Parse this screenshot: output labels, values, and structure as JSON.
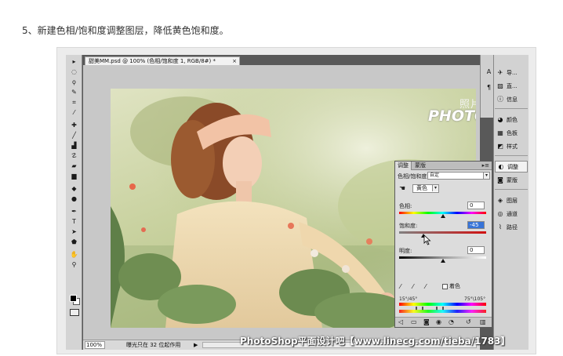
{
  "step_text": "5、新建色相/饱和度调整图层，降低黄色饱和度。",
  "document": {
    "tab_title": "甜美MM.psd @ 100% (色相/饱和度 1, RGB/8#) *",
    "close_glyph": "×"
  },
  "canvas_watermark": {
    "cn": "照片处理网",
    "en": "PHOTOPS.COM"
  },
  "status_bar": {
    "zoom": "100%",
    "info": "曝光只在 32 位起作用",
    "arrow": "▶"
  },
  "toolbar": {
    "tools": [
      {
        "name": "move-tool-icon",
        "glyph": "▸"
      },
      {
        "name": "marquee-tool-icon",
        "glyph": "◌"
      },
      {
        "name": "lasso-tool-icon",
        "glyph": "ϙ"
      },
      {
        "name": "quick-select-tool-icon",
        "glyph": "✎"
      },
      {
        "name": "crop-tool-icon",
        "glyph": "⌗"
      },
      {
        "name": "eyedropper-tool-icon",
        "glyph": "⁄"
      },
      {
        "name": "healing-tool-icon",
        "glyph": "✚"
      },
      {
        "name": "brush-tool-icon",
        "glyph": "╱"
      },
      {
        "name": "stamp-tool-icon",
        "glyph": "▟"
      },
      {
        "name": "history-brush-tool-icon",
        "glyph": "☡"
      },
      {
        "name": "eraser-tool-icon",
        "glyph": "▰"
      },
      {
        "name": "gradient-tool-icon",
        "glyph": "▆"
      },
      {
        "name": "blur-tool-icon",
        "glyph": "◆"
      },
      {
        "name": "dodge-tool-icon",
        "glyph": "●"
      },
      {
        "name": "pen-tool-icon",
        "glyph": "✒"
      },
      {
        "name": "type-tool-icon",
        "glyph": "T"
      },
      {
        "name": "path-select-tool-icon",
        "glyph": "➤"
      },
      {
        "name": "shape-tool-icon",
        "glyph": "⬟"
      },
      {
        "name": "hand-tool-icon",
        "glyph": "✋"
      },
      {
        "name": "zoom-tool-icon",
        "glyph": "⚲"
      }
    ]
  },
  "dock_left_icons": [
    {
      "name": "panel-collapse-icon",
      "glyph": "A"
    },
    {
      "name": "paragraph-icon",
      "glyph": "¶"
    }
  ],
  "dock": {
    "items": [
      {
        "name": "dock-item-navigator",
        "icon": "nav-icon",
        "glyph": "✈",
        "label": "导..."
      },
      {
        "name": "dock-item-histogram",
        "icon": "histogram-icon",
        "glyph": "▨",
        "label": "直..."
      },
      {
        "name": "dock-item-info",
        "icon": "info-icon",
        "glyph": "ⓘ",
        "label": "信息"
      },
      {
        "name": "dock-item-color",
        "icon": "color-icon",
        "glyph": "◕",
        "label": "颜色"
      },
      {
        "name": "dock-item-swatches",
        "icon": "swatches-icon",
        "glyph": "▦",
        "label": "色板"
      },
      {
        "name": "dock-item-styles",
        "icon": "styles-icon",
        "glyph": "◩",
        "label": "样式"
      },
      {
        "name": "dock-item-adjustments",
        "icon": "adjustments-icon",
        "glyph": "◐",
        "label": "调整"
      },
      {
        "name": "dock-item-masks",
        "icon": "masks-icon",
        "glyph": "◙",
        "label": "蒙版"
      },
      {
        "name": "dock-item-layers",
        "icon": "layers-icon",
        "glyph": "◈",
        "label": "图层"
      },
      {
        "name": "dock-item-channels",
        "icon": "channels-icon",
        "glyph": "◎",
        "label": "通道"
      },
      {
        "name": "dock-item-paths",
        "icon": "paths-icon",
        "glyph": "⌇",
        "label": "路径"
      }
    ]
  },
  "adjustments": {
    "tabs": [
      "调整",
      "蒙版"
    ],
    "menu_glyph": "▸≡",
    "title": "色相/饱和度",
    "preset": "自定",
    "select_arrow": "▾",
    "range": "黄色",
    "hue": {
      "label": "色相:",
      "value": "0",
      "slider": 0.5
    },
    "saturation": {
      "label": "饱和度:",
      "value": "-45",
      "slider": 0.275
    },
    "lightness": {
      "label": "明度:",
      "value": "0",
      "slider": 0.5
    },
    "colorize_label": "着色",
    "range_left": "15°/45°",
    "range_right": "75°\\105°"
  },
  "source_watermark": "PhotoShop平面设计吧【www.linecg.com/tieba/1783】"
}
